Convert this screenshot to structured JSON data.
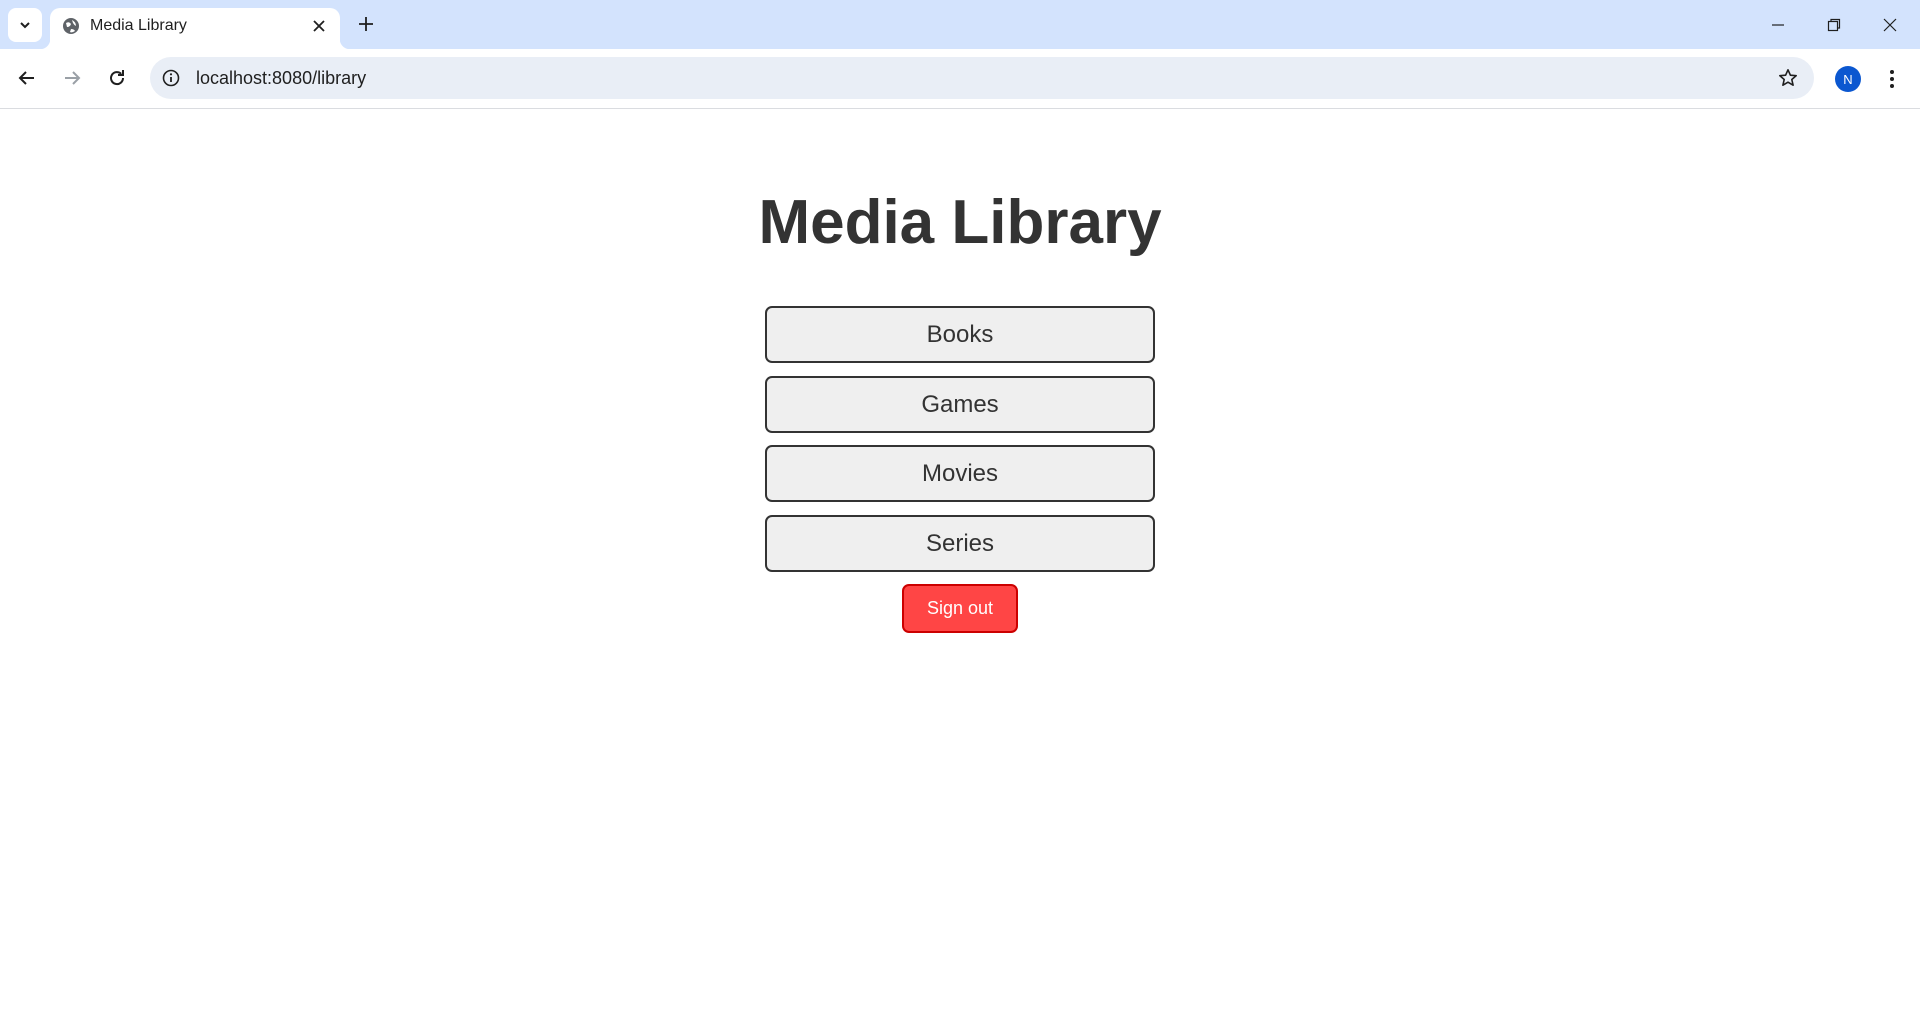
{
  "browser": {
    "tab": {
      "title": "Media Library"
    },
    "omnibox": {
      "url": "localhost:8080/library"
    },
    "profile": {
      "initial": "N",
      "color": "#0b57d0"
    }
  },
  "page": {
    "title": "Media Library",
    "nav_items": [
      {
        "label": "Books"
      },
      {
        "label": "Games"
      },
      {
        "label": "Movies"
      },
      {
        "label": "Series"
      }
    ],
    "sign_out_label": "Sign out"
  },
  "colors": {
    "tabstrip": "#d3e3fd",
    "button_bg": "#efefef",
    "sign_out_bg": "#ff4545",
    "text": "#333333"
  },
  "icons": [
    "tab-search-icon",
    "globe-icon",
    "close-icon",
    "plus-icon",
    "minimize-icon",
    "restore-icon",
    "window-close-icon",
    "back-arrow-icon",
    "forward-arrow-icon",
    "reload-icon",
    "info-icon",
    "star-icon",
    "kebab-menu-icon"
  ]
}
